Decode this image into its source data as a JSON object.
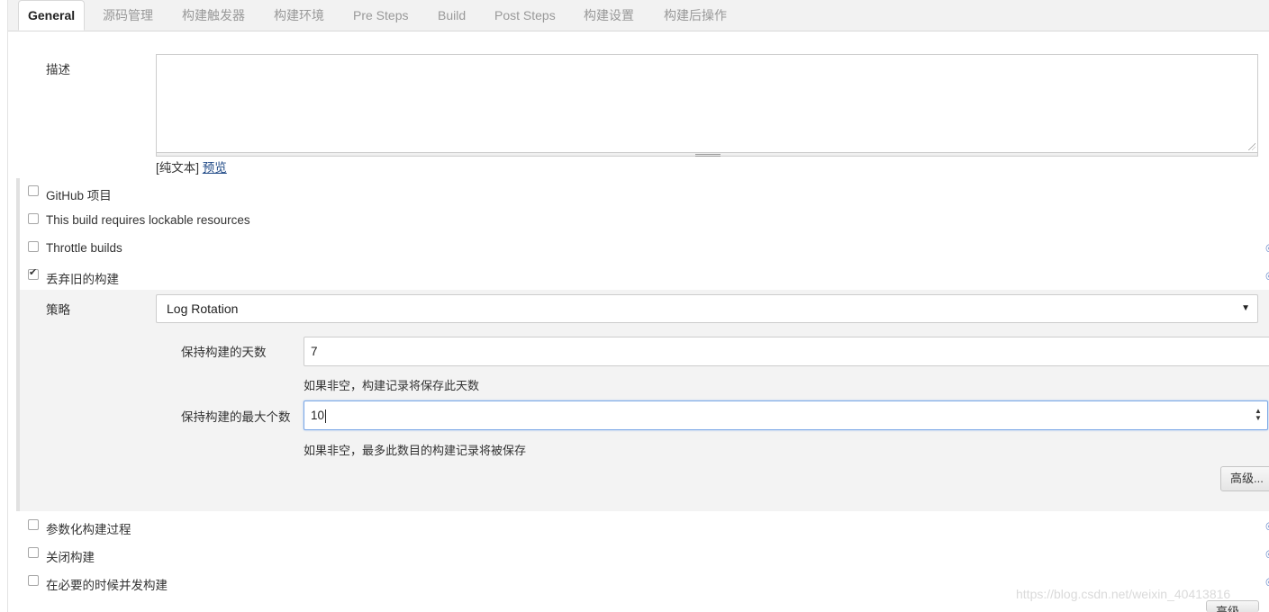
{
  "tabs": [
    {
      "label": "General",
      "active": true
    },
    {
      "label": "源码管理"
    },
    {
      "label": "构建触发器"
    },
    {
      "label": "构建环境"
    },
    {
      "label": "Pre Steps"
    },
    {
      "label": "Build"
    },
    {
      "label": "Post Steps"
    },
    {
      "label": "构建设置"
    },
    {
      "label": "构建后操作"
    }
  ],
  "description": {
    "label": "描述",
    "value": "",
    "markup_prefix": "[纯文本]",
    "preview_link": "预览"
  },
  "options": {
    "github_project": {
      "label": "GitHub 项目",
      "checked": false
    },
    "lockable_resources": {
      "label": "This build requires lockable resources",
      "checked": false
    },
    "throttle_builds": {
      "label": "Throttle builds",
      "checked": false
    },
    "discard_old_builds": {
      "label": "丢弃旧的构建",
      "checked": true
    },
    "parameterized": {
      "label": "参数化构建过程",
      "checked": false
    },
    "disable_build": {
      "label": "关闭构建",
      "checked": false
    },
    "concurrent_builds": {
      "label": "在必要的时候并发构建",
      "checked": false
    }
  },
  "discard": {
    "strategy_label": "策略",
    "strategy_value": "Log Rotation",
    "days_label": "保持构建的天数",
    "days_value": "7",
    "days_hint": "如果非空，构建记录将保存此天数",
    "max_label": "保持构建的最大个数",
    "max_value": "10",
    "max_hint": "如果非空，最多此数目的构建记录将被保存",
    "advanced_button": "高级..."
  },
  "bottom_advanced_button": "高级...",
  "watermark": "https://blog.csdn.net/weixin_40413816",
  "colors": {
    "tab_bar_bg": "#f2f2f2",
    "panel_bg": "#f3f3f3",
    "link": "#204a87",
    "focus_border": "#7aa7e6"
  }
}
